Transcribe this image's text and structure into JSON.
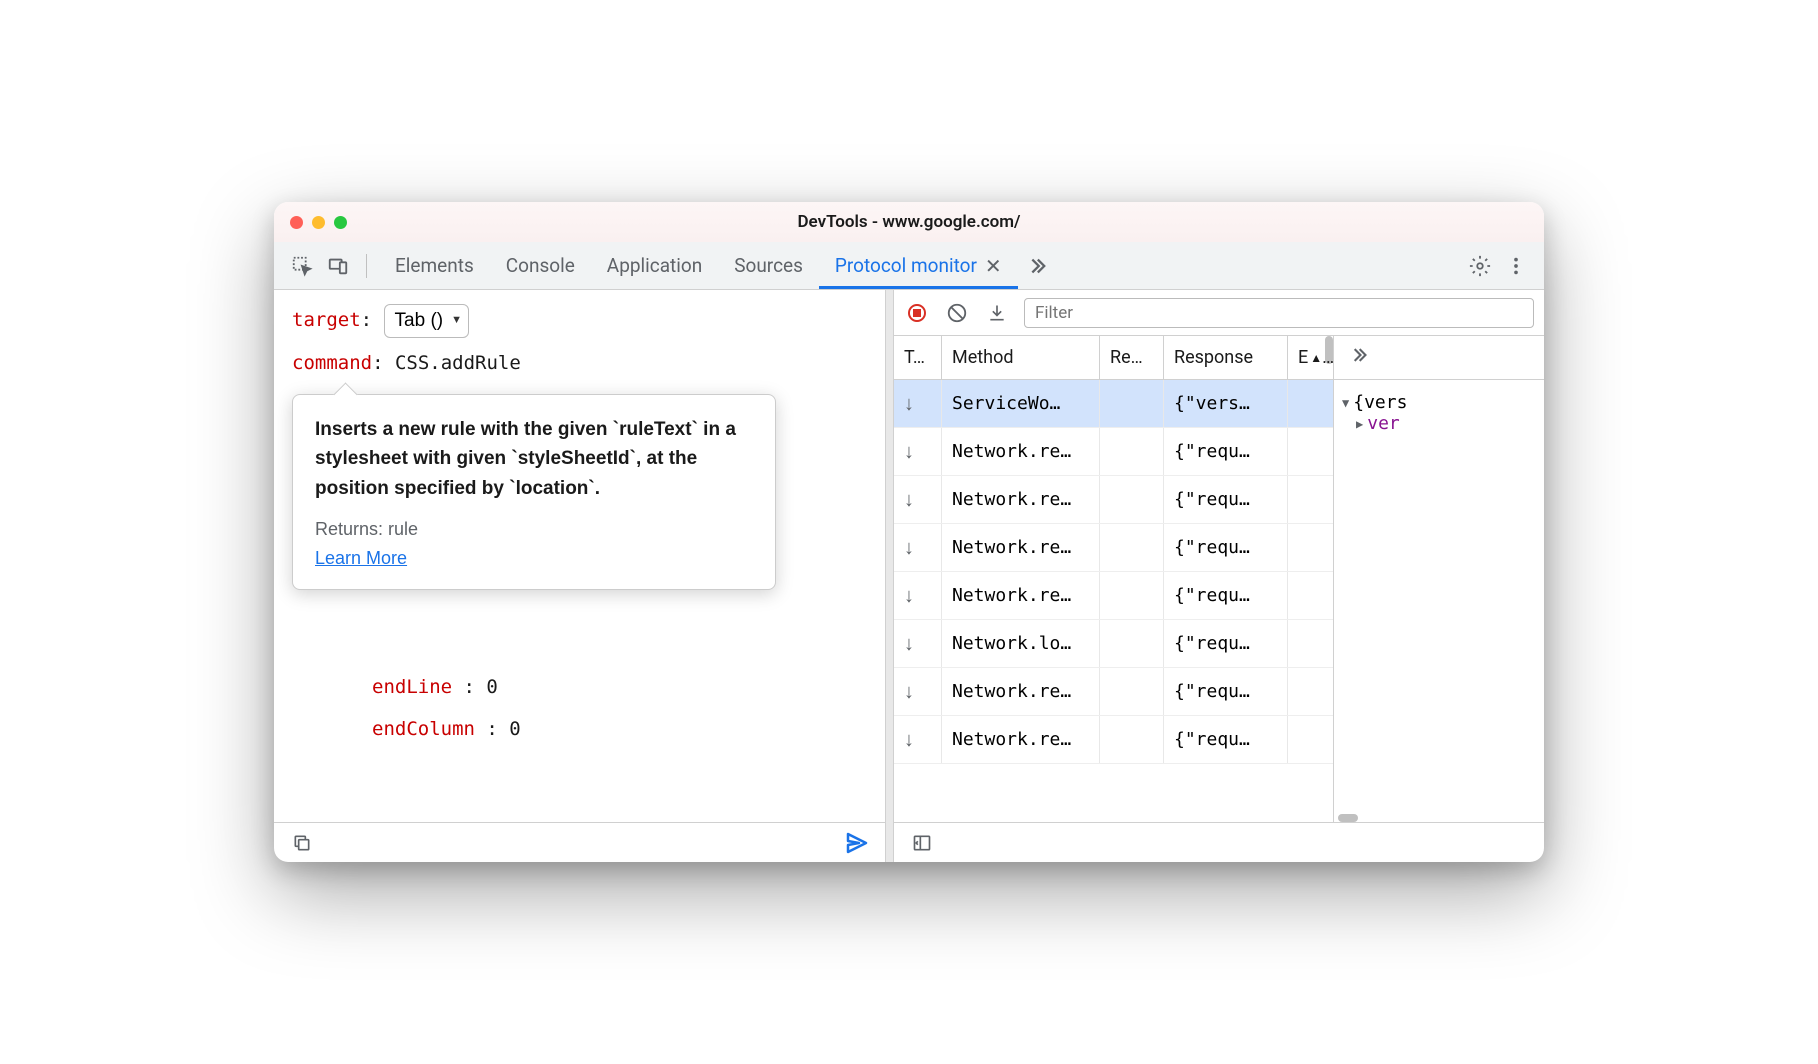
{
  "window": {
    "title": "DevTools - www.google.com/"
  },
  "tabs": {
    "items": [
      "Elements",
      "Console",
      "Application",
      "Sources",
      "Protocol monitor"
    ],
    "active_index": 4
  },
  "editor": {
    "target_label": "target",
    "target_value": "Tab ()",
    "command_label": "command",
    "command_value": "CSS.addRule",
    "params": {
      "endLine_label": "endLine",
      "endLine_value": "0",
      "endColumn_label": "endColumn",
      "endColumn_value": "0"
    }
  },
  "tooltip": {
    "description": "Inserts a new rule with the given `ruleText` in a stylesheet with given `styleSheetId`, at the position specified by `location`.",
    "returns": "Returns: rule",
    "link": "Learn More"
  },
  "filter": {
    "placeholder": "Filter"
  },
  "table": {
    "headers": {
      "t": "T…",
      "method": "Method",
      "re": "Re…",
      "response": "Response",
      "e": "E"
    },
    "rows": [
      {
        "method": "ServiceWo…",
        "response": "{\"vers…",
        "selected": true
      },
      {
        "method": "Network.re…",
        "response": "{\"requ…"
      },
      {
        "method": "Network.re…",
        "response": "{\"requ…"
      },
      {
        "method": "Network.re…",
        "response": "{\"requ…"
      },
      {
        "method": "Network.re…",
        "response": "{\"requ…"
      },
      {
        "method": "Network.lo…",
        "response": "{\"requ…"
      },
      {
        "method": "Network.re…",
        "response": "{\"requ…"
      },
      {
        "method": "Network.re…",
        "response": "{\"requ…"
      }
    ]
  },
  "details": {
    "root": "{vers",
    "key": "ver"
  }
}
